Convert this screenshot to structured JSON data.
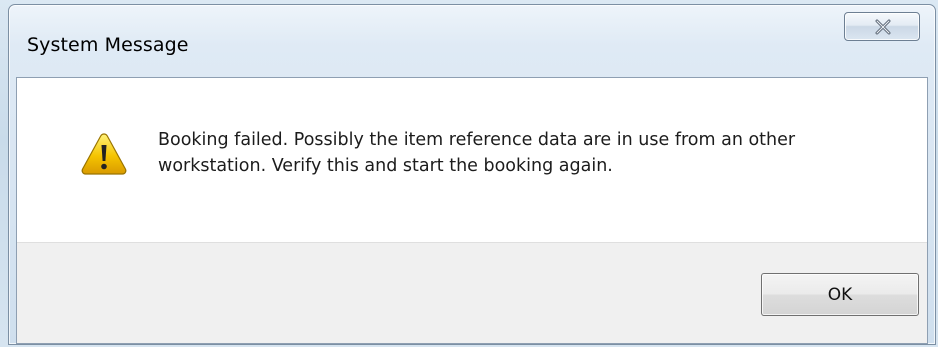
{
  "window": {
    "title": "System Message"
  },
  "message": {
    "text": "Booking failed. Possibly the item reference data are in use from an other workstation. Verify this and start the booking again.",
    "icon": "warning-icon"
  },
  "buttons": {
    "ok_label": "OK"
  },
  "colors": {
    "warning_fill": "#f5c400",
    "button_area_bg": "#f0f0f0",
    "content_bg": "#ffffff"
  }
}
